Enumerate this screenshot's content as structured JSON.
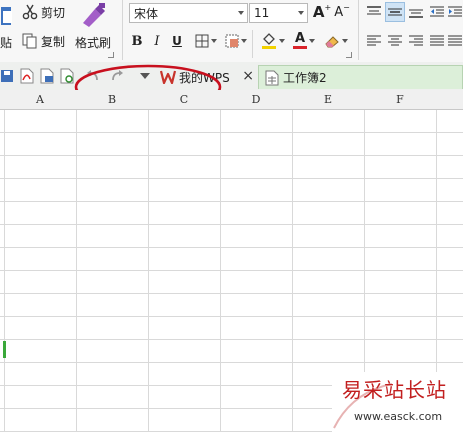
{
  "clipboard": {
    "paste_partial": "贴",
    "cut_label": "剪切",
    "copy_label": "复制",
    "format_painter_label": "格式刷"
  },
  "font": {
    "family": "宋体",
    "size": "11",
    "bold": "B",
    "italic": "I",
    "underline": "U",
    "color_letter": "A"
  },
  "tabs": {
    "my_wps": "我的WPS",
    "workbook": "工作簿2"
  },
  "columns": [
    "A",
    "B",
    "C",
    "D",
    "E",
    "F"
  ],
  "watermark": {
    "title": "易采站长站",
    "url": "www.easck.com"
  },
  "colors": {
    "ribbon_bg": "#f7f7f7",
    "tab_bar_bg": "#eef0ee",
    "wps_red": "#c8342b",
    "highlight_yellow": "#f2d200",
    "font_red": "#d9232a",
    "annotation_red": "#c8101e",
    "active_cell_green": "#3aa83a",
    "watermark_red": "#c21f1f"
  }
}
